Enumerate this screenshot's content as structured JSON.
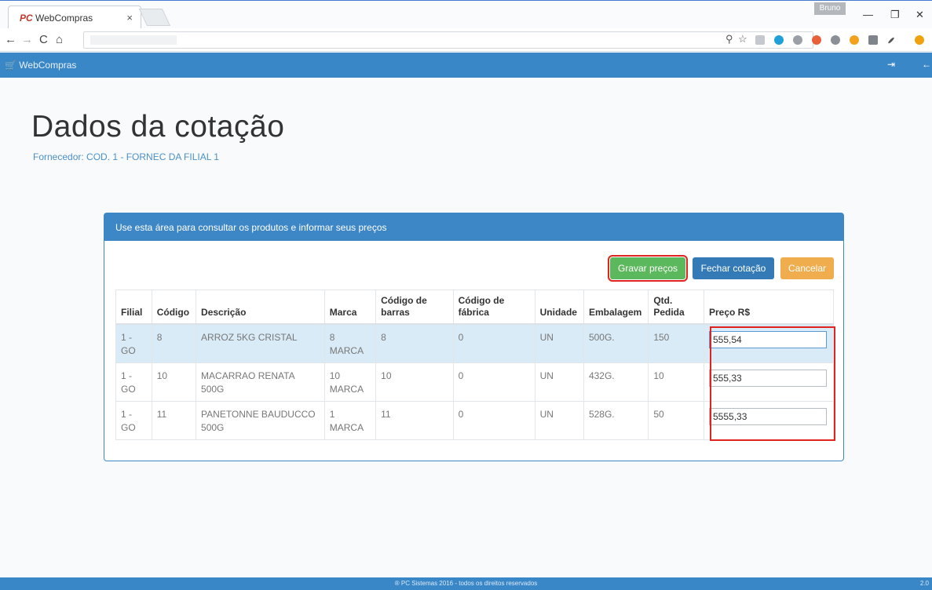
{
  "browser": {
    "tab_title": "WebCompras",
    "tab_close": "×",
    "user": "Bruno",
    "minimize": "—",
    "restore": "❐",
    "close": "✕",
    "back": "←",
    "forward": "→",
    "reload": "C",
    "home": "⌂",
    "bookmark": "☆",
    "key": "⚲"
  },
  "appbar": {
    "brand": "WebCompras",
    "logout_icon": "⇥",
    "back_icon": "←"
  },
  "page": {
    "title": "Dados da cotação",
    "supplier": "Fornecedor: COD. 1 - FORNEC DA FILIAL 1"
  },
  "panel": {
    "heading": "Use esta área para consultar os produtos e informar seus preços",
    "buttons": {
      "save": "Gravar preços",
      "close_quote": "Fechar cotação",
      "cancel": "Cancelar"
    },
    "columns": [
      "Filial",
      "Código",
      "Descrição",
      "Marca",
      "Código de barras",
      "Código de fábrica",
      "Unidade",
      "Embalagem",
      "Qtd. Pedida",
      "Preço R$"
    ],
    "rows": [
      {
        "filial": "1 - GO",
        "codigo": "8",
        "descricao": "ARROZ 5KG CRISTAL",
        "marca": "8 MARCA",
        "barras": "8",
        "fabrica": "0",
        "unidade": "UN",
        "embalagem": "500G.",
        "qtd": "150",
        "preco": "555,54"
      },
      {
        "filial": "1 - GO",
        "codigo": "10",
        "descricao": "MACARRAO RENATA 500G",
        "marca": "10 MARCA",
        "barras": "10",
        "fabrica": "0",
        "unidade": "UN",
        "embalagem": "432G.",
        "qtd": "10",
        "preco": "555,33"
      },
      {
        "filial": "1 - GO",
        "codigo": "11",
        "descricao": "PANETONNE BAUDUCCO 500G",
        "marca": "1 MARCA",
        "barras": "11",
        "fabrica": "0",
        "unidade": "UN",
        "embalagem": "528G.",
        "qtd": "50",
        "preco": "5555,33"
      }
    ]
  },
  "footer": {
    "text": "® PC Sistemas 2016 - todos os direitos reservados",
    "version": "2.0"
  },
  "colors": {
    "primary": "#3a87c8",
    "success": "#5cb85c",
    "warning": "#f0ad4e",
    "highlight": "#e0231f"
  }
}
